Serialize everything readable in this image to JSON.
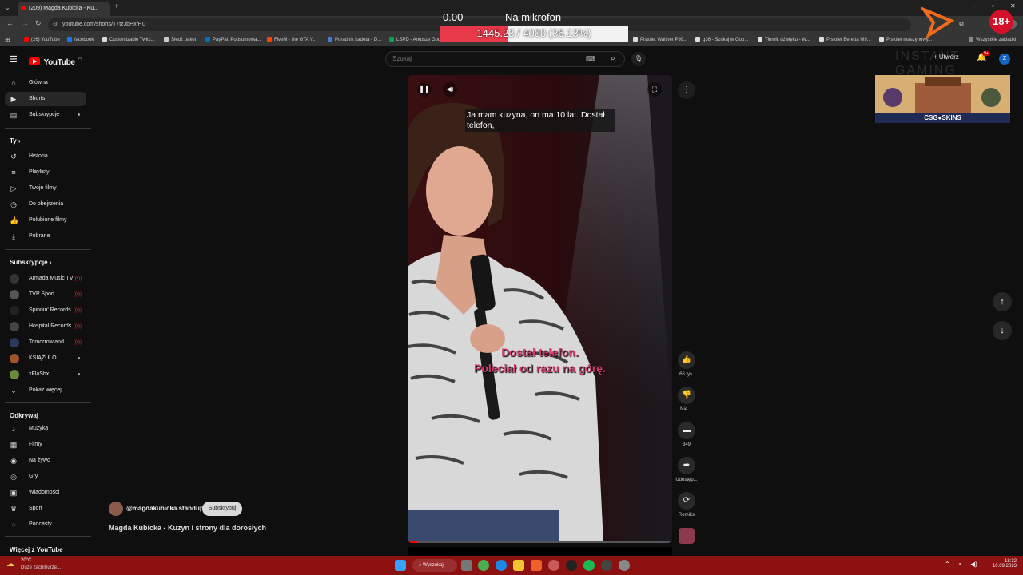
{
  "browser": {
    "tab_title": "(209) Magda Kubicka - Ku...",
    "url": "youtube.com/shorts/T7tzJbHxfHU",
    "bookmarks": [
      "(26) YouTube",
      "facebook",
      "Customizable Twitc...",
      "Śledź paket",
      "PayPal: Podsumowa...",
      "FiveM - the GTA V...",
      "Poradnik kadeta - D...",
      "LSPD - Arkusze Goo...",
      "Pistolet Walther P99...",
      "g36 - Szukaj w Goo...",
      "Tłumik dźwięku - W...",
      "Pistolet Beretta M9...",
      "Pistolet maszynowy...",
      "Wszystkie zakładki"
    ]
  },
  "overlay": {
    "mic_value": "0.00",
    "mic_label": "Na mikrofon",
    "goal_text": "1445.23 / 4000 (36.13%)",
    "goal_progress": 0.3613,
    "ad_brand": "INSTANT GAMING",
    "ad_age": "18+",
    "skins_label": "CSG●SKINS"
  },
  "youtube": {
    "logo": "YouTube",
    "logo_region": "PL",
    "search_placeholder": "Szukaj",
    "create_label": "Utwórz",
    "notif_count": "9+",
    "avatar_letter": "Z",
    "nav": [
      {
        "label": "Główna",
        "icon": "home-icon"
      },
      {
        "label": "Shorts",
        "icon": "shorts-icon"
      },
      {
        "label": "Subskrypcje",
        "icon": "subscriptions-icon"
      }
    ],
    "you_section": "Ty",
    "you_items": [
      "Historia",
      "Playlisty",
      "Twoje filmy",
      "Do obejrzenia",
      "Polubione filmy",
      "Pobrane"
    ],
    "subs_section": "Subskrypcje",
    "subs": [
      {
        "name": "Armada Music TV",
        "live": true,
        "color": "#333"
      },
      {
        "name": "TVP Sport",
        "live": true,
        "color": "#555"
      },
      {
        "name": "Spinnin' Records",
        "live": true,
        "color": "#222"
      },
      {
        "name": "Hospital Records",
        "live": true,
        "color": "#444"
      },
      {
        "name": "Tomorrowland",
        "live": true,
        "color": "#2a3a5a"
      },
      {
        "name": "KSIĄŻULO",
        "live": false,
        "color": "#a0522d"
      },
      {
        "name": "xFlaShx",
        "live": false,
        "color": "#6a8a3a"
      }
    ],
    "show_more": "Pokaż więcej",
    "explore_section": "Odkrywaj",
    "explore_items": [
      "Muzyka",
      "Filmy",
      "Na żywo",
      "Gry",
      "Wiadomości",
      "Sport",
      "Podcasty"
    ],
    "more_section": "Więcej z YouTube",
    "channel_handle": "@magdakubicka.standup",
    "subscribe_label": "Subskrybuj",
    "video_title": "Magda Kubicka - Kuzyn i strony dla dorosłych",
    "caption": "Ja mam kuzyna, on ma 10 lat. Dostał telefon,",
    "subtitle_1": "Dostał telefon.",
    "subtitle_2": "Poleciał od razu na górę.",
    "likes": "66 tys.",
    "dislike_label": "Nie ...",
    "comments": "349",
    "share_label": "Udostęp...",
    "remix_label": "Remiks"
  },
  "taskbar": {
    "weather_temp": "20°C",
    "weather_desc": "Duże zachmurze...",
    "search_label": "Wyszukaj",
    "time": "18:32",
    "date": "10.09.2023"
  }
}
